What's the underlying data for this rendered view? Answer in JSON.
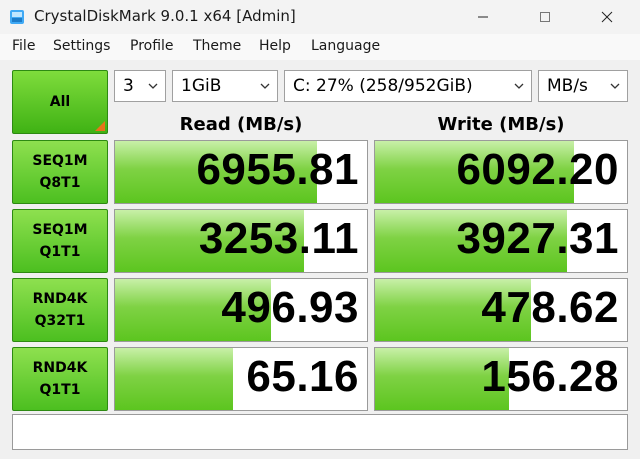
{
  "window": {
    "title": "CrystalDiskMark 9.0.1 x64 [Admin]",
    "icons": {
      "app": "crystaldiskmark-app-icon",
      "minimize": "minimize-icon",
      "maximize": "maximize-icon",
      "close": "close-icon"
    }
  },
  "menu": [
    "File",
    "Settings",
    "Profile",
    "Theme",
    "Help",
    "Language"
  ],
  "toolbar": {
    "all_label": "All",
    "count": "3",
    "size": "1GiB",
    "drive": "C: 27% (258/952GiB)",
    "unit": "MB/s"
  },
  "headers": {
    "read": "Read (MB/s)",
    "write": "Write (MB/s)"
  },
  "tests": [
    {
      "line1": "SEQ1M",
      "line2": "Q8T1",
      "read": "6955.81",
      "write": "6092.20",
      "read_fill": 0.8,
      "write_fill": 0.79
    },
    {
      "line1": "SEQ1M",
      "line2": "Q1T1",
      "read": "3253.11",
      "write": "3927.31",
      "read_fill": 0.75,
      "write_fill": 0.76
    },
    {
      "line1": "RND4K",
      "line2": "Q32T1",
      "read": "496.93",
      "write": "478.62",
      "read_fill": 0.62,
      "write_fill": 0.62
    },
    {
      "line1": "RND4K",
      "line2": "Q1T1",
      "read": "65.16",
      "write": "156.28",
      "read_fill": 0.47,
      "write_fill": 0.53
    }
  ],
  "status_text": "",
  "colors": {
    "accent_green": "#5cc51f",
    "corner_orange": "#e8731b"
  }
}
